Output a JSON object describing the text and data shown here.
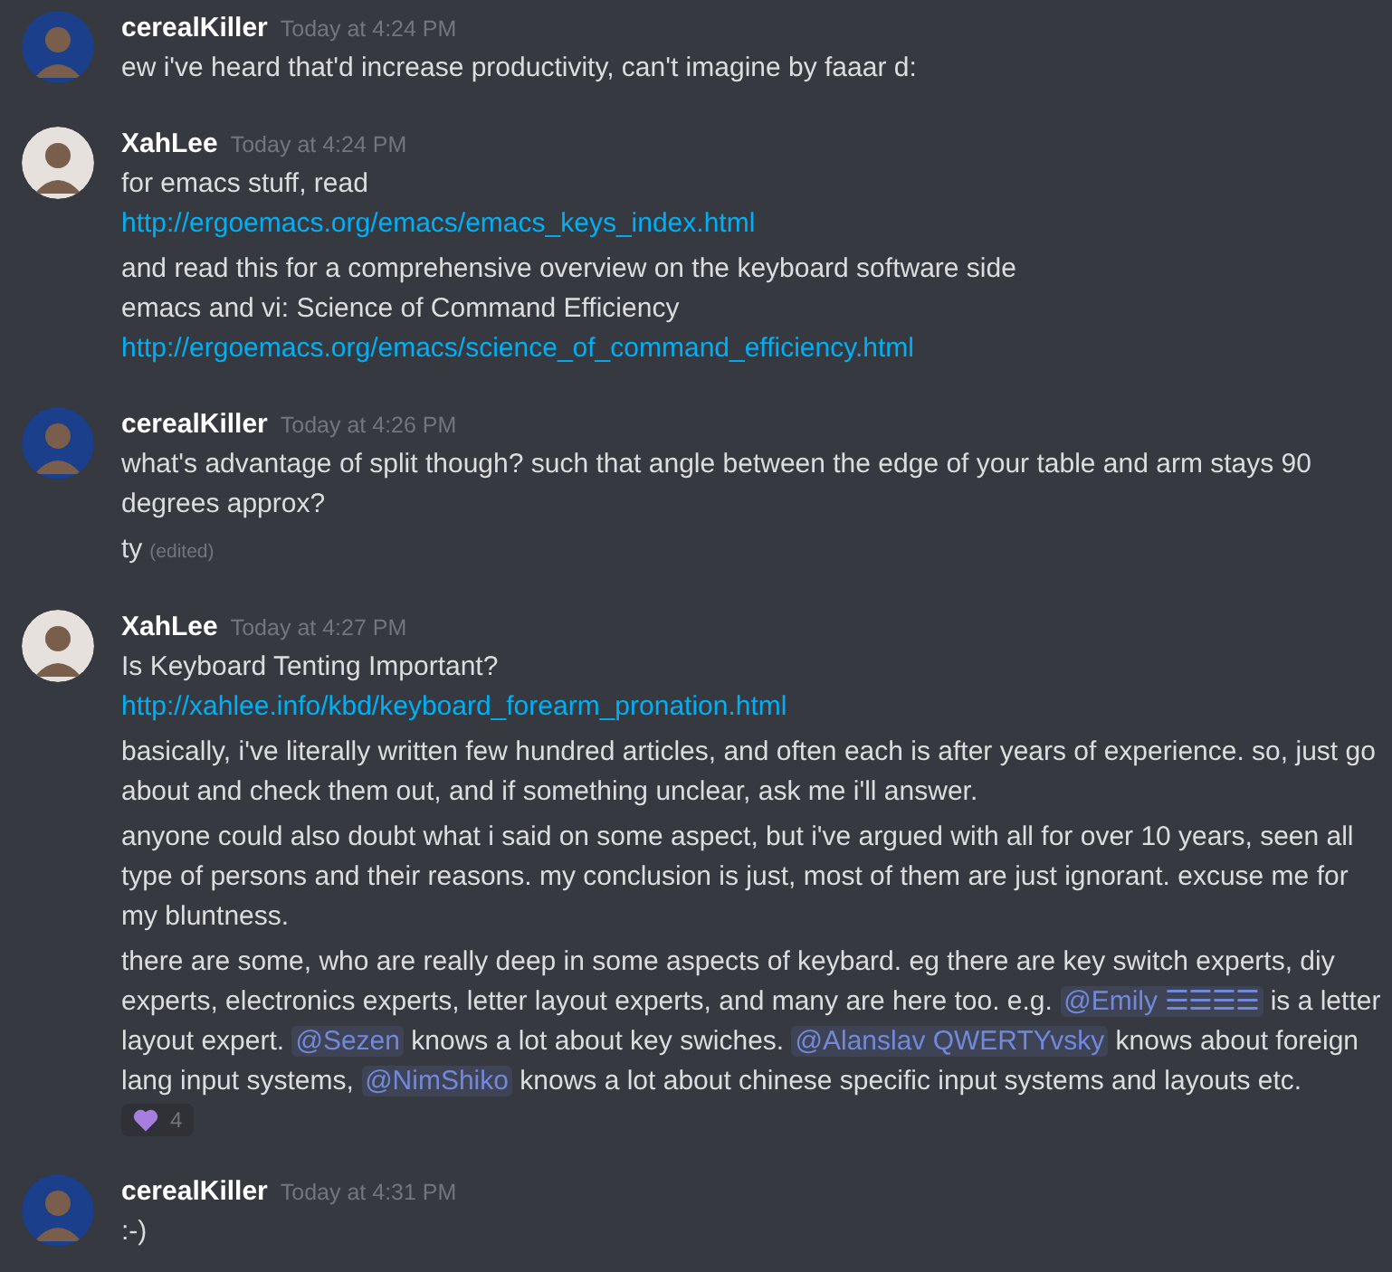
{
  "messages": [
    {
      "author": "cerealKiller",
      "avatar": {
        "color": "#1b3f8a"
      },
      "time": "Today at 4:24 PM",
      "posts": [
        {
          "lines": [
            {
              "parts": [
                {
                  "kind": "text",
                  "text": "ew i've heard that'd increase productivity, can't imagine by faaar d:"
                }
              ]
            }
          ]
        }
      ]
    },
    {
      "author": "XahLee",
      "avatar": {
        "color": "#e6e1dc"
      },
      "time": "Today at 4:24 PM",
      "posts": [
        {
          "lines": [
            {
              "parts": [
                {
                  "kind": "text",
                  "text": "for emacs stuff, read"
                }
              ]
            },
            {
              "parts": [
                {
                  "kind": "link",
                  "text": "http://ergoemacs.org/emacs/emacs_keys_index.html"
                }
              ]
            }
          ]
        },
        {
          "lines": [
            {
              "parts": [
                {
                  "kind": "text",
                  "text": "and read this for a comprehensive overview on the keyboard software side"
                }
              ]
            },
            {
              "parts": [
                {
                  "kind": "text",
                  "text": "emacs and vi: Science of Command Efficiency"
                }
              ]
            },
            {
              "parts": [
                {
                  "kind": "link",
                  "text": "http://ergoemacs.org/emacs/science_of_command_efficiency.html"
                }
              ]
            }
          ]
        }
      ]
    },
    {
      "author": "cerealKiller",
      "avatar": {
        "color": "#1b3f8a"
      },
      "time": "Today at 4:26 PM",
      "posts": [
        {
          "lines": [
            {
              "parts": [
                {
                  "kind": "text",
                  "text": "what's advantage of split though? such that angle between the edge of your table and arm stays 90 degrees approx?"
                }
              ]
            }
          ]
        },
        {
          "lines": [
            {
              "parts": [
                {
                  "kind": "text",
                  "text": "ty"
                }
              ]
            }
          ],
          "edited": "(edited)"
        }
      ]
    },
    {
      "author": "XahLee",
      "avatar": {
        "color": "#e6e1dc"
      },
      "time": "Today at 4:27 PM",
      "posts": [
        {
          "lines": [
            {
              "parts": [
                {
                  "kind": "text",
                  "text": "Is Keyboard Tenting Important?"
                }
              ]
            },
            {
              "parts": [
                {
                  "kind": "link",
                  "text": "http://xahlee.info/kbd/keyboard_forearm_pronation.html"
                }
              ]
            }
          ]
        },
        {
          "lines": [
            {
              "parts": [
                {
                  "kind": "text",
                  "text": "basically, i've literally written few hundred articles, and often each is after years of experience. so, just go about and check them out, and if something unclear, ask me i'll answer."
                }
              ]
            }
          ]
        },
        {
          "lines": [
            {
              "parts": [
                {
                  "kind": "text",
                  "text": "anyone could also doubt what i said on some aspect, but i've argued with all for over 10 years, seen all type of persons and their reasons. my conclusion is just, most of them are just ignorant. excuse me for my bluntness."
                }
              ]
            }
          ]
        },
        {
          "lines": [
            {
              "parts": [
                {
                  "kind": "text",
                  "text": "there are some, who are really deep in some aspects of keybard. eg there are key switch experts, diy experts, electronics experts, letter layout experts, and many are here too. e.g. "
                },
                {
                  "kind": "mention",
                  "text": "@Emily ☰☰☰☰"
                },
                {
                  "kind": "text",
                  "text": " is a letter layout expert. "
                },
                {
                  "kind": "mention",
                  "text": "@Sezen"
                },
                {
                  "kind": "text",
                  "text": " knows a lot about key swiches. "
                },
                {
                  "kind": "mention",
                  "text": "@Alanslav QWERTYvsky"
                },
                {
                  "kind": "text",
                  "text": " knows about foreign lang input systems, "
                },
                {
                  "kind": "mention",
                  "text": "@NimShiko"
                },
                {
                  "kind": "text",
                  "text": " knows a lot about chinese specific input systems and layouts etc."
                }
              ]
            }
          ],
          "reaction": {
            "count": "4"
          }
        }
      ]
    },
    {
      "author": "cerealKiller",
      "avatar": {
        "color": "#1b3f8a"
      },
      "time": "Today at 4:31 PM",
      "posts": [
        {
          "lines": [
            {
              "parts": [
                {
                  "kind": "text",
                  "text": ":-)"
                }
              ]
            }
          ]
        }
      ]
    }
  ]
}
